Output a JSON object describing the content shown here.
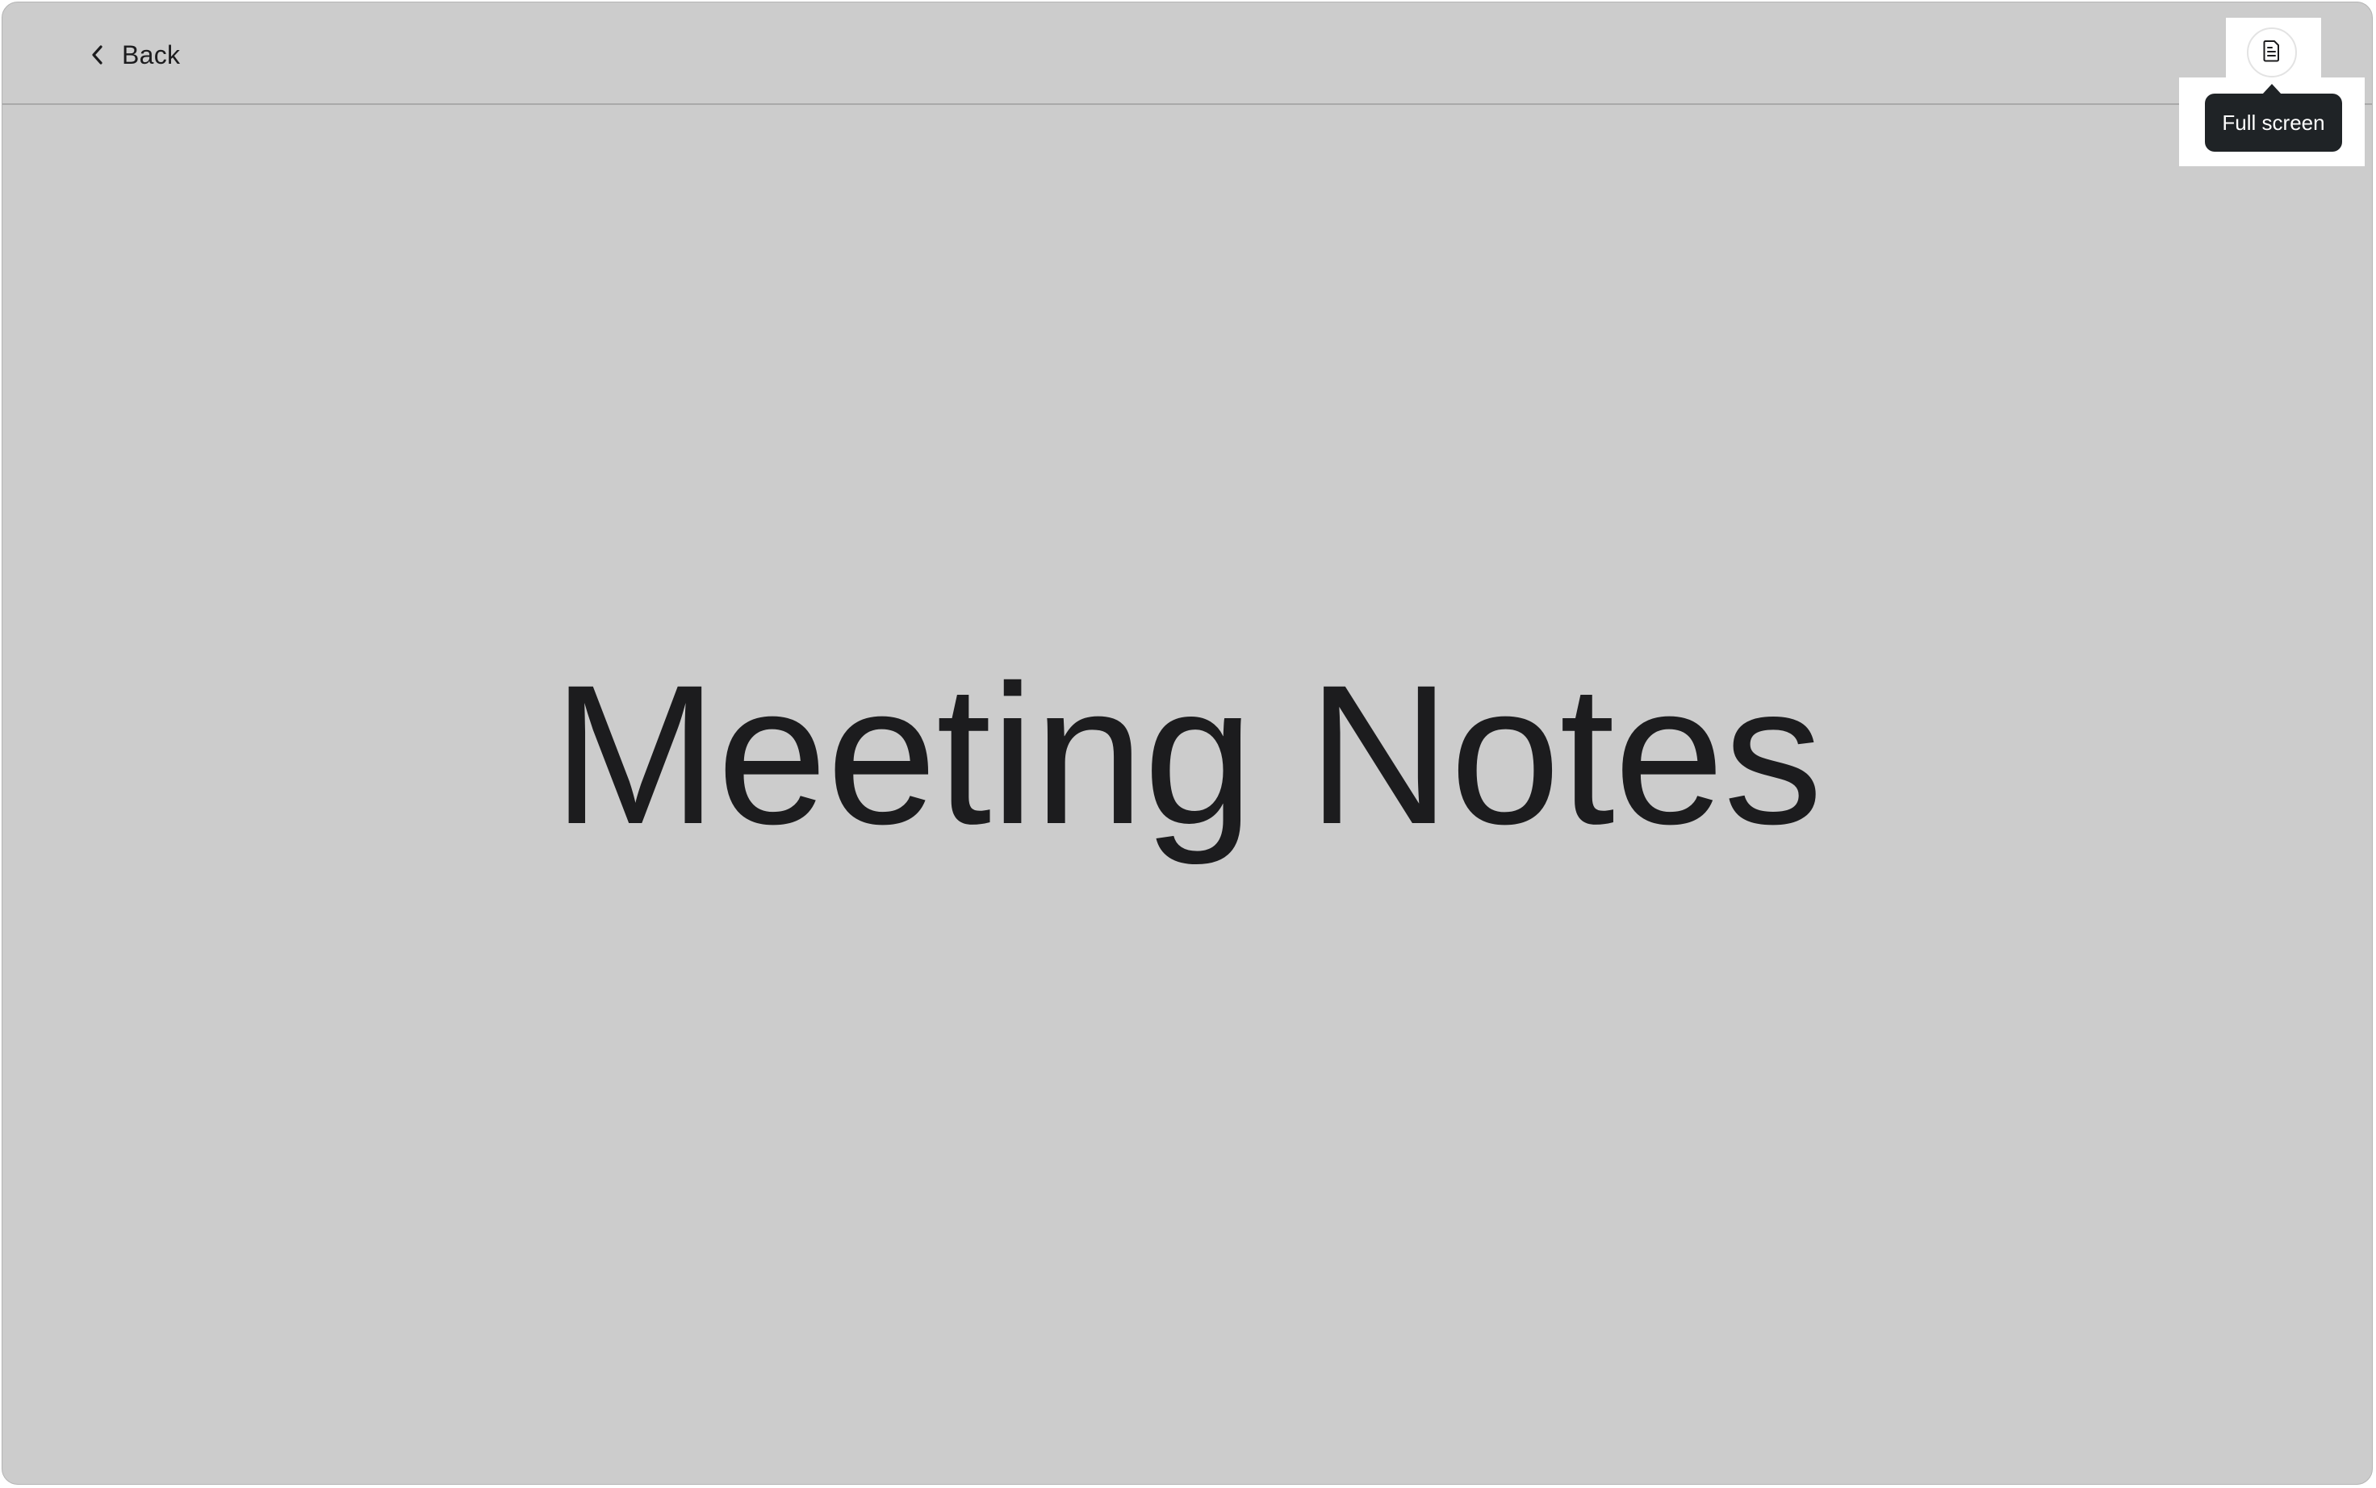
{
  "topbar": {
    "back_label": "Back",
    "back_icon": "chevron-left-icon",
    "fullscreen_icon": "document-icon",
    "fullscreen_tooltip": "Full screen"
  },
  "main": {
    "title": "Meeting Notes"
  },
  "colors": {
    "background": "#cccccc",
    "text": "#1c1c1e",
    "tooltip_bg": "#1f2326",
    "tooltip_text": "#ffffff"
  }
}
